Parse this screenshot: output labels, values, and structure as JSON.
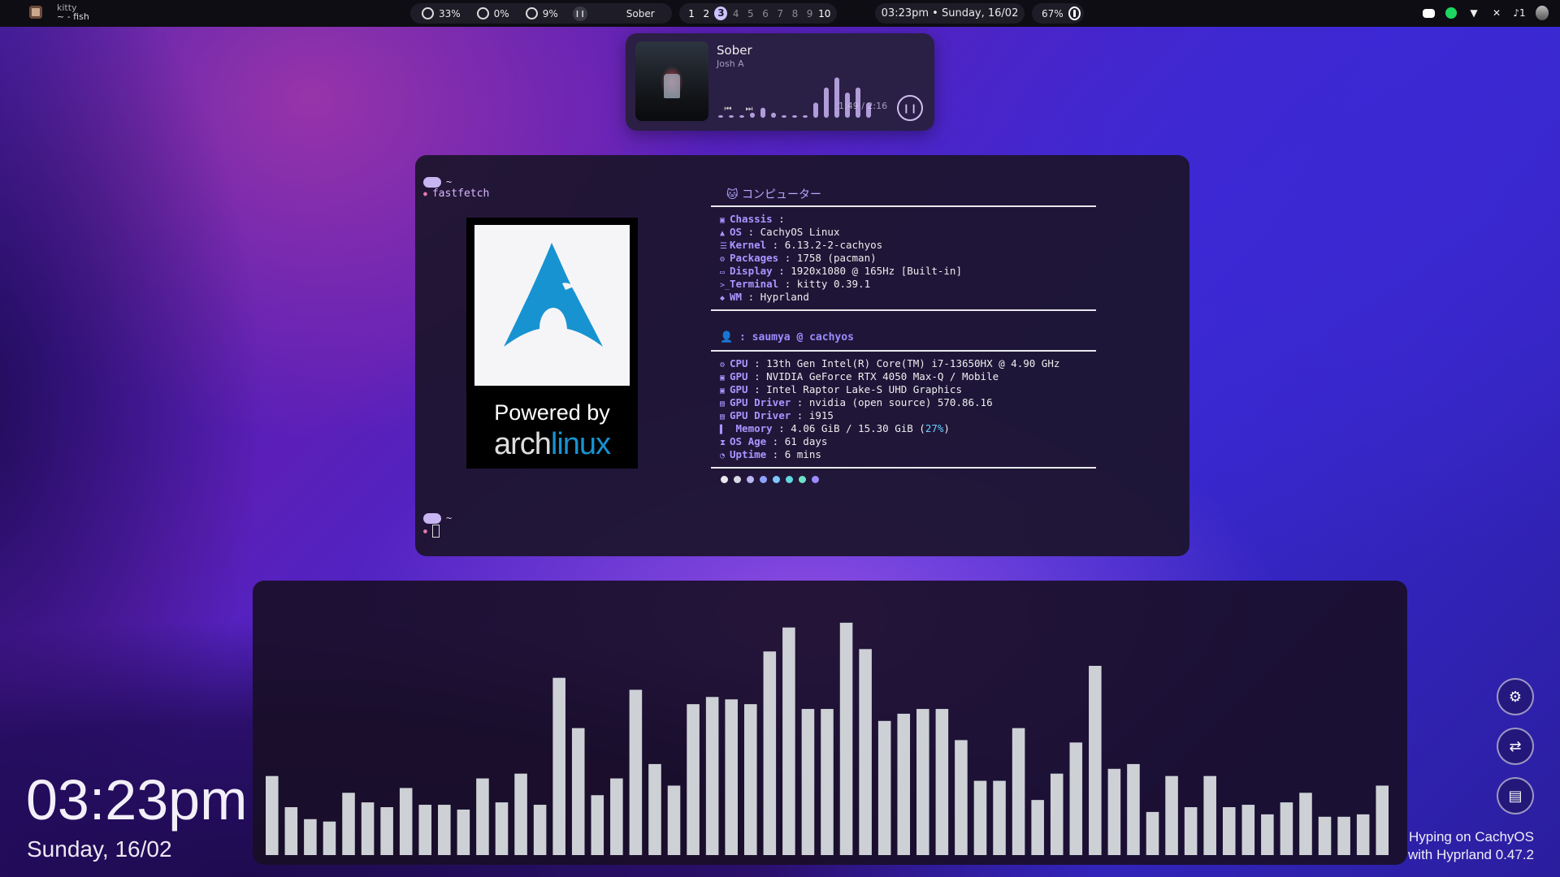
{
  "topbar": {
    "app_class": "kitty",
    "app_title": "~ - fish",
    "cpu": "33%",
    "gpu": "0%",
    "mem": "9%",
    "media_title": "Sober",
    "workspaces": [
      "1",
      "2",
      "3",
      "4",
      "5",
      "6",
      "7",
      "8",
      "9",
      "10"
    ],
    "workspace_active": "3",
    "workspaces_occupied": [
      "1",
      "2",
      "3",
      "10"
    ],
    "clock": "03:23pm • Sunday, 16/02",
    "battery": "67%",
    "notifications": "1"
  },
  "media": {
    "title": "Sober",
    "artist": "Josh A",
    "time": "1:49 / 2:16",
    "progress": 0.8,
    "levels": [
      0.05,
      0.05,
      0.05,
      0.1,
      0.2,
      0.1,
      0.05,
      0.05,
      0.05,
      0.3,
      0.6,
      0.8,
      0.5,
      0.6,
      0.3
    ]
  },
  "terminal": {
    "prompt_dir": "~",
    "command": "fastfetch",
    "logo": {
      "powered_by": "Powered by",
      "arch": "arch",
      "linux": "linux"
    },
    "header": "🐱 コンピューター",
    "group1": [
      {
        "icon": "▣",
        "key": "Chassis",
        "sep": " : ",
        "value": ""
      },
      {
        "icon": "▲",
        "key": "OS",
        "sep": " : ",
        "value": "CachyOS Linux"
      },
      {
        "icon": "☰",
        "key": "Kernel",
        "sep": " : ",
        "value": "6.13.2-2-cachyos"
      },
      {
        "icon": "⚙",
        "key": "Packages",
        "sep": " : ",
        "value": "1758 (pacman)"
      },
      {
        "icon": "▭",
        "key": "Display",
        "sep": " : ",
        "value": "1920x1080 @ 165Hz [Built-in]"
      },
      {
        "icon": ">_",
        "key": "Terminal",
        "sep": " : ",
        "value": "kitty 0.39.1"
      },
      {
        "icon": "◆",
        "key": "WM",
        "sep": " : ",
        "value": "Hyprland"
      }
    ],
    "user_line": "👤 : saumya @ cachyos",
    "group2": [
      {
        "icon": "⚙",
        "key": "CPU",
        "sep": " : ",
        "value": "13th Gen Intel(R) Core(TM) i7-13650HX @ 4.90 GHz"
      },
      {
        "icon": "▣",
        "key": "GPU",
        "sep": " : ",
        "value": "NVIDIA GeForce RTX 4050 Max-Q / Mobile"
      },
      {
        "icon": "▣",
        "key": "GPU",
        "sep": " : ",
        "value": "Intel Raptor Lake-S UHD Graphics"
      },
      {
        "icon": "▤",
        "key": "GPU Driver",
        "sep": " : ",
        "value": "nvidia (open source) 570.86.16"
      },
      {
        "icon": "▤",
        "key": "GPU Driver",
        "sep": " : ",
        "value": "i915"
      },
      {
        "icon": "▌",
        "key": " Memory",
        "sep": " : ",
        "value": "4.06 GiB / 15.30 GiB (",
        "pct": "27%",
        "tail": ")"
      },
      {
        "icon": "⧗",
        "key": "OS Age",
        "sep": "  : ",
        "value": "61 days"
      },
      {
        "icon": "◔",
        "key": "Uptime",
        "sep": "  : ",
        "value": "6 mins"
      }
    ],
    "dots": [
      "#e8e8ee",
      "#d9d9e6",
      "#b9b6f2",
      "#8fa0ff",
      "#7fc6ff",
      "#5fd8e0",
      "#6fe0c8",
      "#9a8cff"
    ]
  },
  "visualizer": {
    "levels": [
      0.33,
      0.2,
      0.15,
      0.14,
      0.26,
      0.22,
      0.2,
      0.28,
      0.21,
      0.21,
      0.19,
      0.32,
      0.22,
      0.34,
      0.21,
      0.74,
      0.53,
      0.25,
      0.32,
      0.69,
      0.38,
      0.29,
      0.63,
      0.66,
      0.65,
      0.63,
      0.85,
      0.95,
      0.61,
      0.61,
      0.97,
      0.86,
      0.56,
      0.59,
      0.61,
      0.61,
      0.48,
      0.31,
      0.31,
      0.53,
      0.23,
      0.34,
      0.47,
      0.79,
      0.36,
      0.38,
      0.18,
      0.33,
      0.2,
      0.33,
      0.2,
      0.21,
      0.17,
      0.22,
      0.26,
      0.16,
      0.16,
      0.17,
      0.29
    ]
  },
  "desktop": {
    "time": "03:23pm",
    "date": "Sunday, 16/02",
    "footer_line1": "Hyping on CachyOS",
    "footer_line2": "with Hyprland 0.47.2"
  }
}
